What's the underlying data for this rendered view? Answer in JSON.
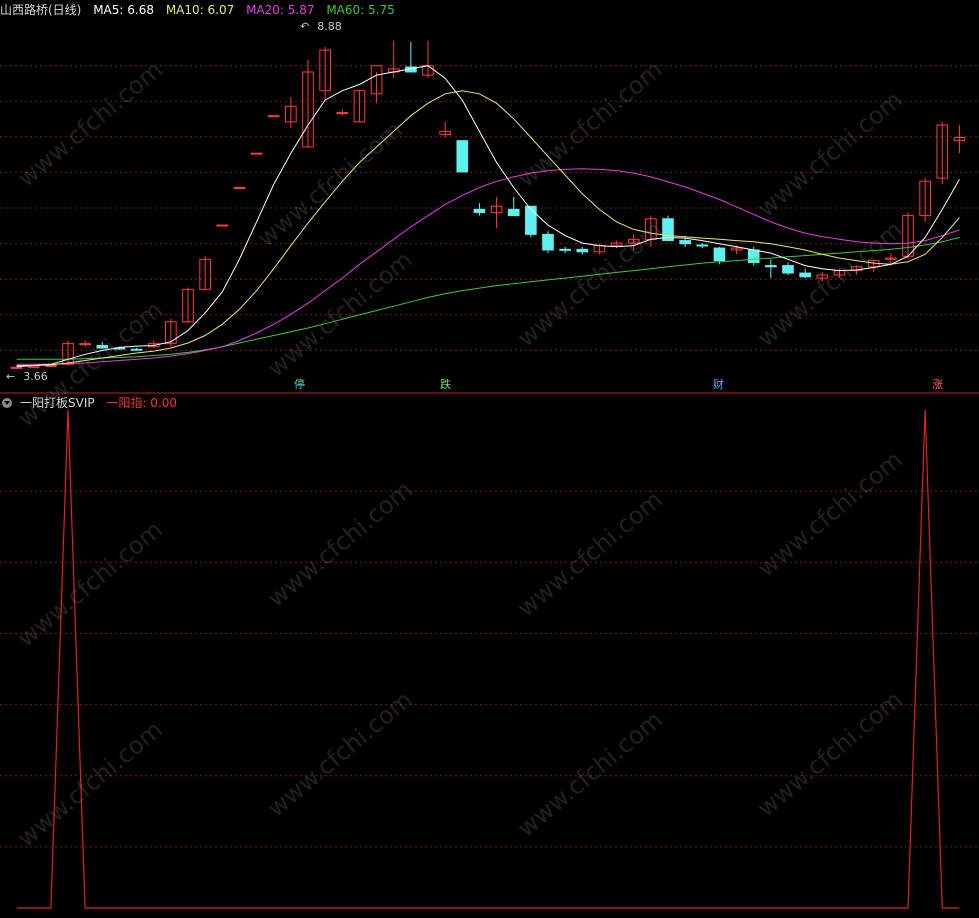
{
  "header": {
    "stock_title": "山西路桥(日线)",
    "ma5_label": "MA5: 6.68",
    "ma10_label": "MA10: 6.07",
    "ma20_label": "MA20: 5.87",
    "ma60_label": "MA60: 5.75"
  },
  "indicator": {
    "name": "一阳打板SVIP",
    "value_label": "一阳指: 0.00"
  },
  "annotations": {
    "high_label": "8.88",
    "low_label": "3.66"
  },
  "event_tags": [
    {
      "text": "停",
      "color": "#5fd1d1"
    },
    {
      "text": "跌",
      "color": "#7ddf5f"
    },
    {
      "text": "财",
      "color": "#5fa8ff"
    },
    {
      "text": "涨",
      "color": "#ff6060"
    }
  ],
  "watermark": "www.cfchi.com",
  "colors": {
    "up": "#ff3b3b",
    "down": "#5ff0f0",
    "ma5": "#ffffff",
    "ma10": "#e8e87a",
    "ma20": "#e040e0",
    "ma60": "#3ec83e",
    "indicator": "#e0202a",
    "grid": "#7a1a1a"
  },
  "chart_data": [
    {
      "type": "candlestick",
      "title": "山西路桥(日线)",
      "ylim": [
        3.5,
        9.2
      ],
      "candles": [
        [
          3.66,
          3.68,
          3.64,
          3.67
        ],
        [
          3.67,
          3.7,
          3.65,
          3.69
        ],
        [
          3.7,
          3.72,
          3.67,
          3.7
        ],
        [
          3.72,
          4.1,
          3.7,
          4.05
        ],
        [
          4.05,
          4.1,
          4.0,
          4.05
        ],
        [
          4.02,
          4.08,
          3.98,
          3.98
        ],
        [
          3.98,
          4.0,
          3.95,
          3.97
        ],
        [
          3.96,
          3.98,
          3.94,
          3.95
        ],
        [
          4.0,
          4.1,
          3.98,
          4.05
        ],
        [
          4.05,
          4.45,
          4.0,
          4.4
        ],
        [
          4.4,
          4.95,
          4.38,
          4.92
        ],
        [
          4.92,
          5.45,
          4.9,
          5.4
        ],
        [
          5.95,
          5.95,
          5.95,
          5.95
        ],
        [
          6.55,
          6.55,
          6.55,
          6.55
        ],
        [
          7.1,
          7.1,
          7.1,
          7.1
        ],
        [
          7.7,
          7.7,
          7.7,
          7.7
        ],
        [
          7.6,
          8.0,
          7.5,
          7.85
        ],
        [
          7.2,
          8.6,
          7.2,
          8.4
        ],
        [
          8.1,
          8.8,
          7.95,
          8.75
        ],
        [
          7.75,
          7.8,
          7.7,
          7.75
        ],
        [
          7.6,
          8.1,
          7.6,
          8.1
        ],
        [
          8.05,
          8.4,
          7.9,
          8.5
        ],
        [
          8.4,
          8.9,
          8.3,
          8.45
        ],
        [
          8.48,
          8.88,
          8.4,
          8.4
        ],
        [
          8.35,
          8.9,
          8.3,
          8.5
        ],
        [
          7.4,
          7.6,
          7.35,
          7.45
        ],
        [
          7.3,
          7.3,
          6.8,
          6.8
        ],
        [
          6.2,
          6.3,
          6.1,
          6.15
        ],
        [
          6.15,
          6.4,
          5.9,
          6.25
        ],
        [
          6.2,
          6.4,
          6.1,
          6.1
        ],
        [
          6.25,
          6.25,
          5.75,
          5.8
        ],
        [
          5.8,
          5.85,
          5.5,
          5.55
        ],
        [
          5.56,
          5.6,
          5.5,
          5.55
        ],
        [
          5.56,
          5.6,
          5.48,
          5.52
        ],
        [
          5.52,
          5.65,
          5.48,
          5.62
        ],
        [
          5.62,
          5.7,
          5.58,
          5.66
        ],
        [
          5.66,
          5.8,
          5.55,
          5.72
        ],
        [
          5.72,
          6.1,
          5.6,
          6.05
        ],
        [
          6.05,
          6.1,
          5.7,
          5.7
        ],
        [
          5.7,
          5.75,
          5.6,
          5.65
        ],
        [
          5.63,
          5.66,
          5.58,
          5.62
        ],
        [
          5.58,
          5.6,
          5.32,
          5.38
        ],
        [
          5.55,
          5.62,
          5.48,
          5.58
        ],
        [
          5.55,
          5.6,
          5.3,
          5.35
        ],
        [
          5.3,
          5.4,
          5.1,
          5.28
        ],
        [
          5.3,
          5.35,
          5.15,
          5.18
        ],
        [
          5.18,
          5.25,
          5.1,
          5.12
        ],
        [
          5.1,
          5.2,
          5.05,
          5.15
        ],
        [
          5.15,
          5.25,
          5.1,
          5.22
        ],
        [
          5.22,
          5.3,
          5.15,
          5.28
        ],
        [
          5.28,
          5.4,
          5.2,
          5.38
        ],
        [
          5.4,
          5.5,
          5.3,
          5.42
        ],
        [
          5.45,
          6.15,
          5.4,
          6.1
        ],
        [
          6.1,
          6.7,
          6.0,
          6.65
        ],
        [
          6.7,
          7.6,
          6.6,
          7.55
        ],
        [
          7.3,
          7.55,
          7.1,
          7.35
        ]
      ],
      "ma5": [
        3.68,
        3.7,
        3.72,
        3.8,
        3.88,
        3.94,
        3.99,
        4.01,
        4.02,
        4.08,
        4.26,
        4.54,
        4.88,
        5.4,
        6.0,
        6.6,
        7.1,
        7.55,
        7.95,
        8.1,
        8.2,
        8.35,
        8.4,
        8.45,
        8.5,
        8.3,
        7.95,
        7.45,
        6.95,
        6.55,
        6.2,
        5.95,
        5.78,
        5.66,
        5.62,
        5.6,
        5.62,
        5.72,
        5.75,
        5.74,
        5.7,
        5.65,
        5.6,
        5.55,
        5.5,
        5.4,
        5.3,
        5.25,
        5.22,
        5.23,
        5.27,
        5.32,
        5.45,
        5.75,
        6.2,
        6.68
      ],
      "ma10": [
        3.7,
        3.7,
        3.71,
        3.74,
        3.78,
        3.82,
        3.86,
        3.9,
        3.93,
        3.98,
        4.06,
        4.18,
        4.36,
        4.6,
        4.9,
        5.25,
        5.62,
        5.98,
        6.32,
        6.65,
        6.95,
        7.2,
        7.45,
        7.7,
        7.9,
        8.05,
        8.1,
        8.05,
        7.9,
        7.65,
        7.35,
        7.05,
        6.75,
        6.45,
        6.2,
        6.0,
        5.88,
        5.82,
        5.78,
        5.76,
        5.74,
        5.72,
        5.7,
        5.68,
        5.65,
        5.6,
        5.55,
        5.48,
        5.42,
        5.38,
        5.34,
        5.32,
        5.36,
        5.48,
        5.75,
        6.07
      ],
      "ma20": [
        3.72,
        3.72,
        3.72,
        3.73,
        3.74,
        3.76,
        3.78,
        3.8,
        3.82,
        3.85,
        3.89,
        3.94,
        4.0,
        4.1,
        4.22,
        4.36,
        4.52,
        4.7,
        4.9,
        5.1,
        5.32,
        5.52,
        5.72,
        5.92,
        6.1,
        6.28,
        6.42,
        6.55,
        6.65,
        6.72,
        6.78,
        6.82,
        6.84,
        6.85,
        6.84,
        6.82,
        6.78,
        6.72,
        6.64,
        6.56,
        6.46,
        6.36,
        6.24,
        6.12,
        6.0,
        5.9,
        5.82,
        5.76,
        5.72,
        5.68,
        5.66,
        5.65,
        5.66,
        5.7,
        5.78,
        5.87
      ],
      "ma60": [
        3.8,
        3.8,
        3.8,
        3.8,
        3.81,
        3.82,
        3.83,
        3.84,
        3.86,
        3.88,
        3.91,
        3.95,
        4.0,
        4.06,
        4.12,
        4.18,
        4.24,
        4.3,
        4.37,
        4.44,
        4.51,
        4.58,
        4.65,
        4.72,
        4.79,
        4.85,
        4.9,
        4.94,
        4.98,
        5.01,
        5.04,
        5.07,
        5.1,
        5.13,
        5.16,
        5.19,
        5.22,
        5.25,
        5.28,
        5.31,
        5.34,
        5.36,
        5.38,
        5.4,
        5.42,
        5.44,
        5.46,
        5.48,
        5.5,
        5.52,
        5.54,
        5.56,
        5.59,
        5.63,
        5.68,
        5.75
      ]
    },
    {
      "type": "line",
      "title": "一阳打板SVIP",
      "series": [
        {
          "name": "一阳指",
          "values": [
            0,
            0,
            0,
            1,
            0,
            0,
            0,
            0,
            0,
            0,
            0,
            0,
            0,
            0,
            0,
            0,
            0,
            0,
            0,
            0,
            0,
            0,
            0,
            0,
            0,
            0,
            0,
            0,
            0,
            0,
            0,
            0,
            0,
            0,
            0,
            0,
            0,
            0,
            0,
            0,
            0,
            0,
            0,
            0,
            0,
            0,
            0,
            0,
            0,
            0,
            0,
            0,
            0,
            1,
            0,
            0
          ]
        }
      ],
      "ylim": [
        0,
        1
      ]
    }
  ]
}
